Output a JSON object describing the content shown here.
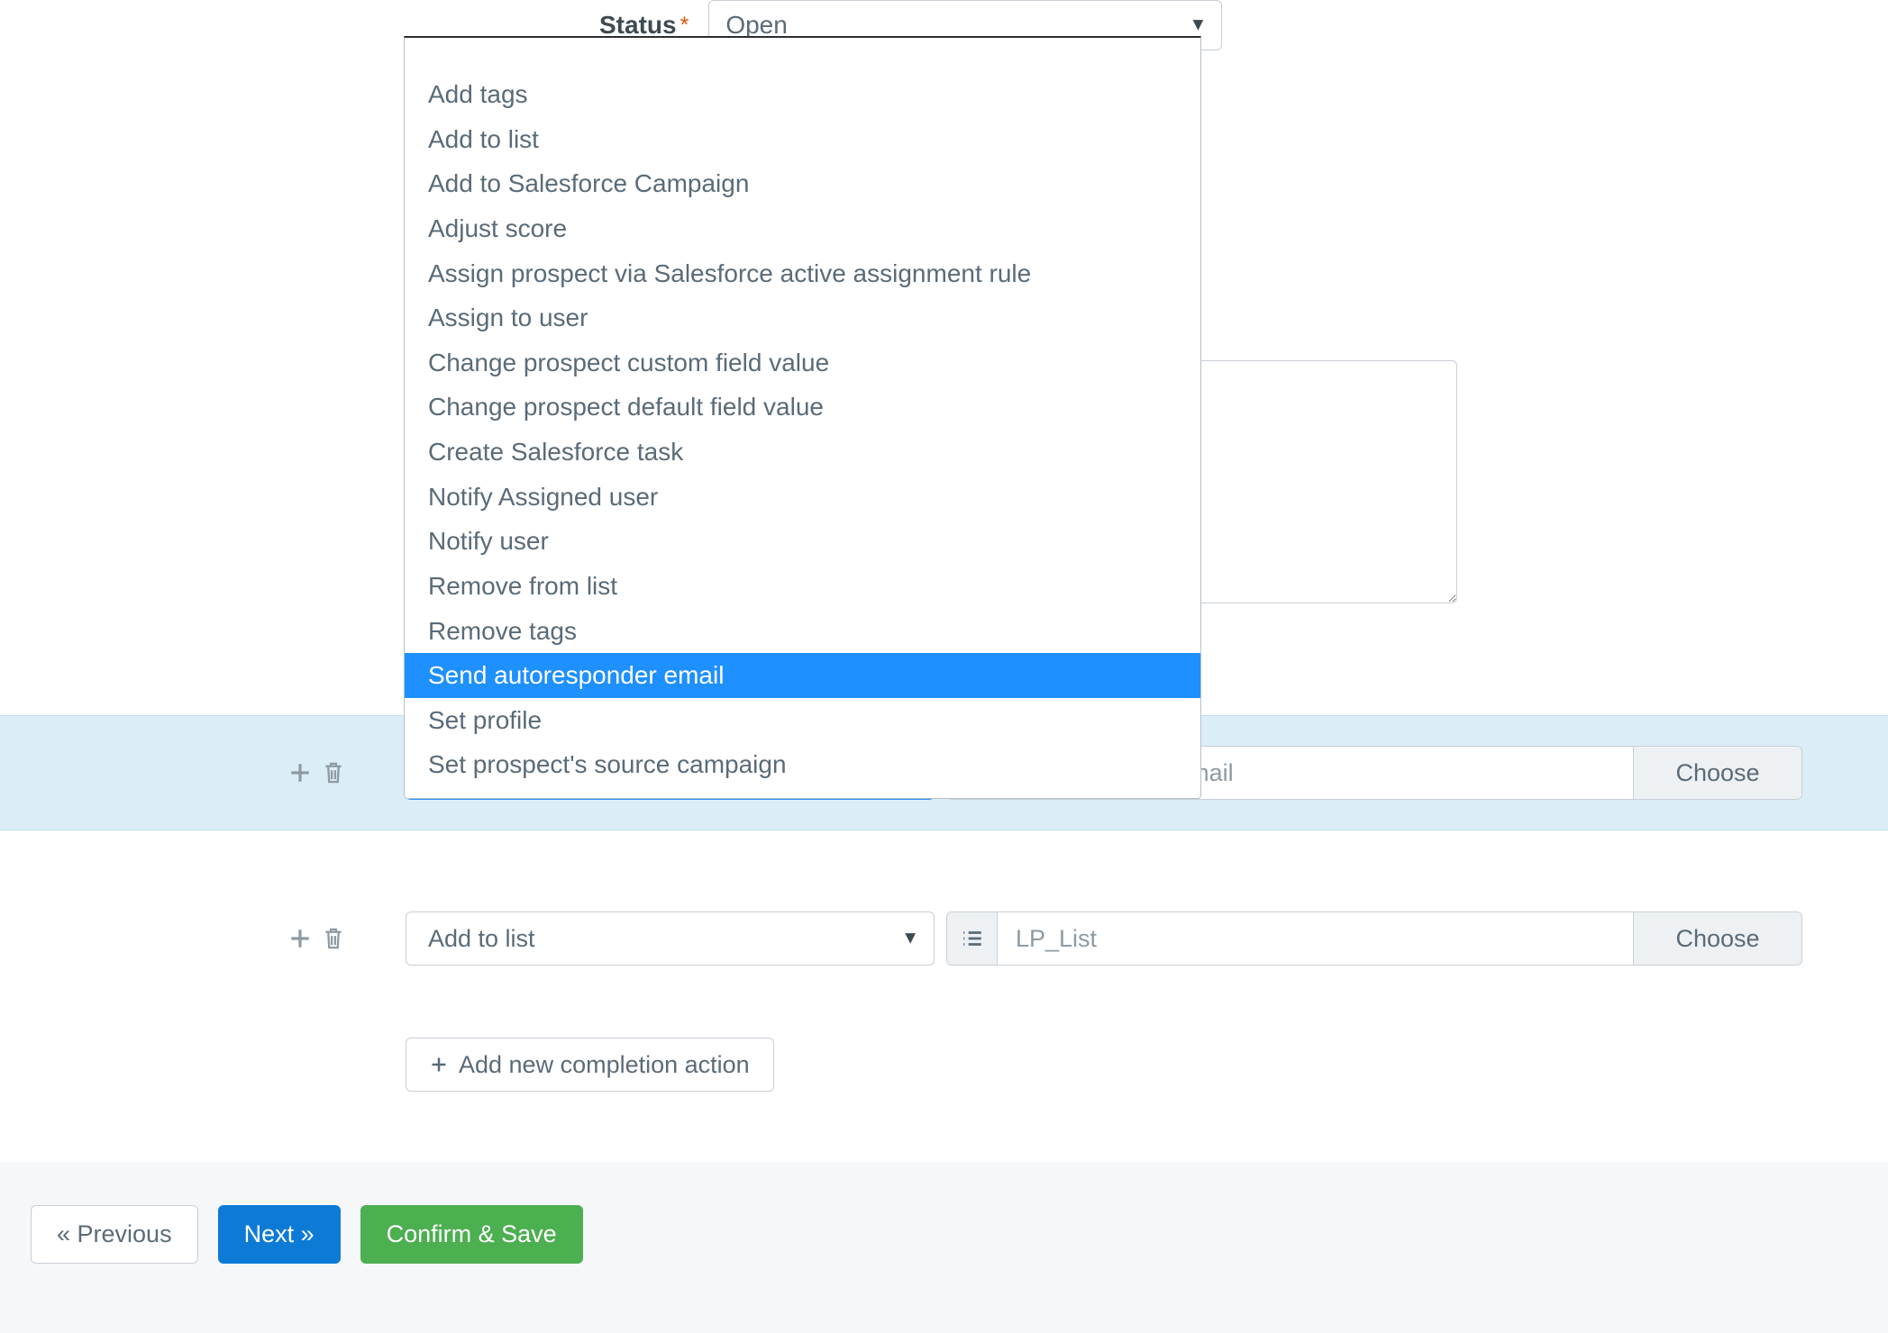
{
  "status": {
    "label": "Status",
    "value": "Open"
  },
  "dropdown": {
    "items": [
      "Add tags",
      "Add to list",
      "Add to Salesforce Campaign",
      "Adjust score",
      "Assign prospect via Salesforce active assignment rule",
      "Assign to user",
      "Change prospect custom field value",
      "Change prospect default field value",
      "Create Salesforce task",
      "Notify Assigned user",
      "Notify user",
      "Remove from list",
      "Remove tags",
      "Send autoresponder email",
      "Set profile",
      "Set prospect's source campaign"
    ],
    "selected_index": 13
  },
  "row1": {
    "action": "Send autoresponder email",
    "target": "TEST_ExposeEmail",
    "choose": "Choose"
  },
  "row2": {
    "action": "Add to list",
    "target": "LP_List",
    "choose": "Choose"
  },
  "add_new": "Add new completion action",
  "buttons": {
    "prev": "«  Previous",
    "next": "Next  »",
    "confirm": "Confirm & Save"
  }
}
